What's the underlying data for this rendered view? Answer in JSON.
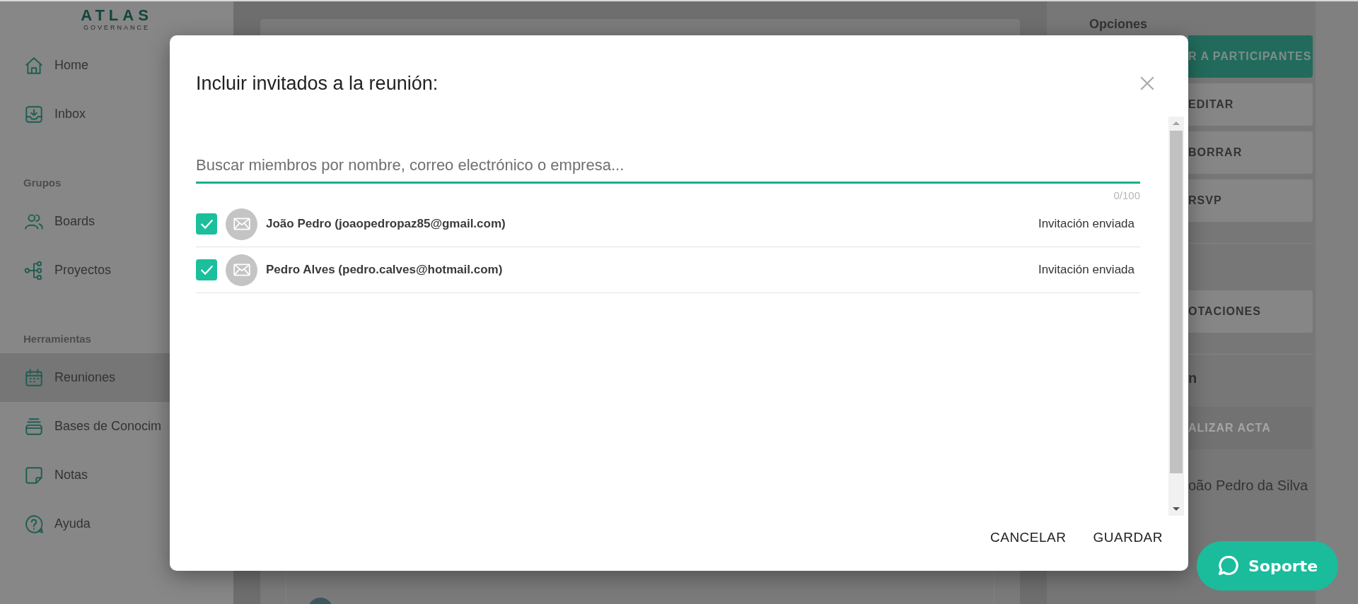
{
  "sidebar": {
    "logo": {
      "title": "ATLAS",
      "subtitle": "GOVERNANCE"
    },
    "sections": [
      {
        "items": [
          {
            "label": "Home",
            "selected": false
          },
          {
            "label": "Inbox",
            "selected": false
          }
        ]
      },
      {
        "heading": "Grupos",
        "items": [
          {
            "label": "Boards",
            "selected": false
          },
          {
            "label": "Proyectos",
            "selected": false
          }
        ]
      },
      {
        "heading": "Herramientas",
        "items": [
          {
            "label": "Reuniones",
            "selected": true
          },
          {
            "label": "Bases de Conocim",
            "selected": false
          },
          {
            "label": "Notas",
            "selected": false
          },
          {
            "label": "Ayuda",
            "selected": false
          }
        ]
      }
    ]
  },
  "options_heading": "Opciones",
  "right_panel": [
    {
      "kind": "primary_button",
      "label": "R A PARTICIPANTES"
    },
    {
      "kind": "button",
      "label": "EDITAR"
    },
    {
      "kind": "button",
      "label": "BORRAR"
    },
    {
      "kind": "button",
      "label": "RSVP"
    },
    {
      "kind": "divider"
    },
    {
      "kind": "button",
      "label": "OTACIONES"
    },
    {
      "kind": "divider"
    },
    {
      "kind": "heading",
      "text": "n"
    },
    {
      "kind": "disabled_button",
      "label": "ALIZAR ACTA"
    },
    {
      "kind": "text",
      "text": "oão Pedro da Silva"
    }
  ],
  "dialog": {
    "title": "Incluir invitados a la reunión:",
    "search": {
      "placeholder": "Buscar miembros por nombre, correo electrónico o empresa...",
      "counter": "0/100"
    },
    "invitees": [
      {
        "name": "João Pedro (joaopedropaz85@gmail.com)",
        "checked": true,
        "status": "Invitación enviada"
      },
      {
        "name": "Pedro Alves (pedro.calves@hotmail.com)",
        "checked": true,
        "status": "Invitación enviada"
      }
    ],
    "actions": [
      "CANCELAR",
      "GUARDAR"
    ]
  },
  "support_button": {
    "label": "Soporte"
  }
}
